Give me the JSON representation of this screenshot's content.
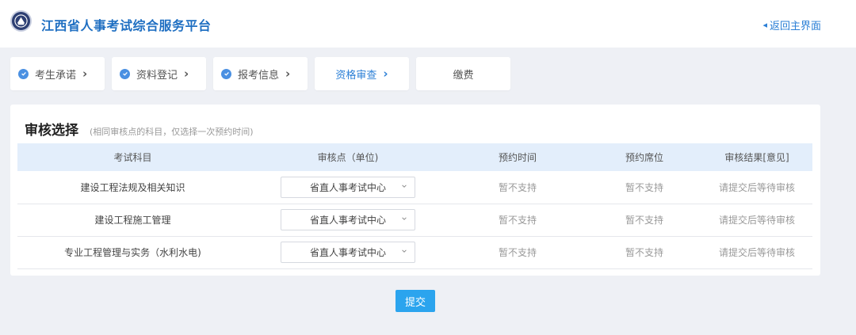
{
  "header": {
    "title": "江西省人事考试综合服务平台",
    "back_label": "返回主界面"
  },
  "steps": [
    {
      "label": "考生承诺",
      "status": "done"
    },
    {
      "label": "资料登记",
      "status": "done"
    },
    {
      "label": "报考信息",
      "status": "done"
    },
    {
      "label": "资格审查",
      "status": "active"
    },
    {
      "label": "缴费",
      "status": "todo"
    }
  ],
  "panel": {
    "title": "审核选择",
    "subtitle": "(相同审核点的科目，仅选择一次预约时间)",
    "columns": [
      "考试科目",
      "审核点（单位)",
      "预约时间",
      "预约席位",
      "审核结果[意见]"
    ],
    "rows": [
      {
        "subject": "建设工程法规及相关知识",
        "audit_point": "省直人事考试中心",
        "time": "暂不支持",
        "seat": "暂不支持",
        "result": "请提交后等待审核"
      },
      {
        "subject": "建设工程施工管理",
        "audit_point": "省直人事考试中心",
        "time": "暂不支持",
        "seat": "暂不支持",
        "result": "请提交后等待审核"
      },
      {
        "subject": "专业工程管理与实务（水利水电)",
        "audit_point": "省直人事考试中心",
        "time": "暂不支持",
        "seat": "暂不支持",
        "result": "请提交后等待审核"
      }
    ]
  },
  "submit_label": "提交",
  "colors": {
    "accent": "#2b7fd6",
    "title": "#1f6fc2",
    "header_row": "#e3eefb",
    "submit": "#2ba4ee",
    "background": "#eef0f5"
  }
}
